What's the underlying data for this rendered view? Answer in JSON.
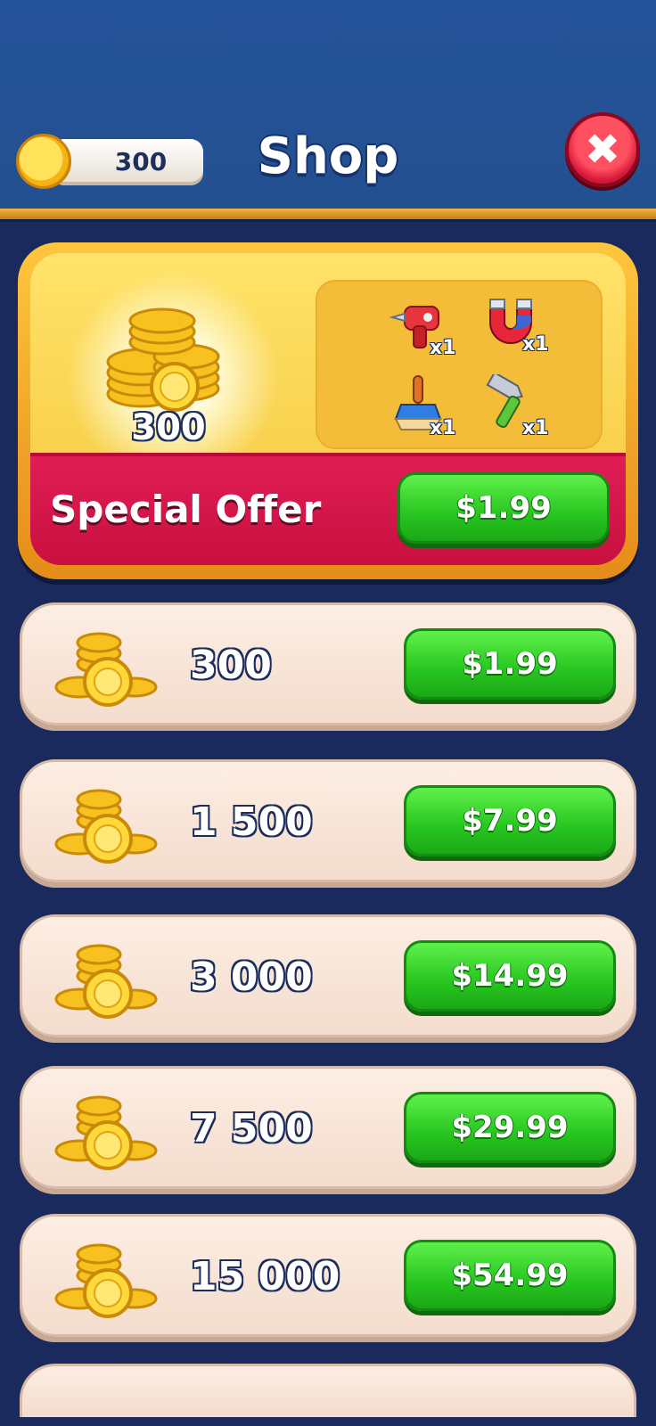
{
  "header": {
    "coin_balance": "300",
    "title": "Shop",
    "close_icon": "close-icon"
  },
  "special_offer": {
    "coins": "300",
    "label": "Special Offer",
    "price": "$1.99",
    "items": [
      {
        "icon": "drill-icon",
        "qty": "x1"
      },
      {
        "icon": "magnet-icon",
        "qty": "x1"
      },
      {
        "icon": "brush-icon",
        "qty": "x1"
      },
      {
        "icon": "hammer-icon",
        "qty": "x1"
      }
    ]
  },
  "packs": [
    {
      "coins": "300",
      "price": "$1.99"
    },
    {
      "coins": "1 500",
      "price": "$7.99"
    },
    {
      "coins": "3 000",
      "price": "$14.99"
    },
    {
      "coins": "7 500",
      "price": "$29.99"
    },
    {
      "coins": "15 000",
      "price": "$54.99"
    }
  ],
  "colors": {
    "background": "#1b2a5c",
    "header": "#25539a",
    "buy_button": "#27c51f",
    "special_bar": "#e01d55",
    "card": "#fdeee3"
  }
}
